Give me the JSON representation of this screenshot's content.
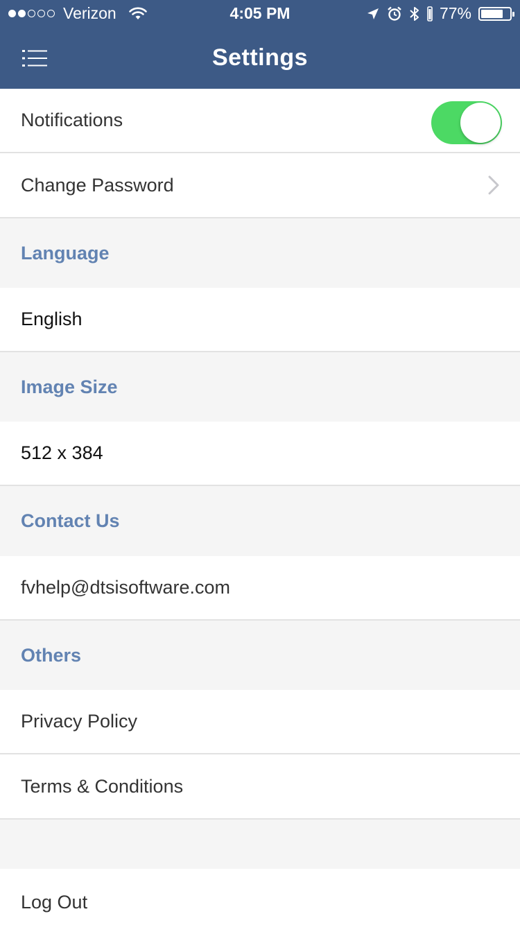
{
  "status_bar": {
    "carrier": "Verizon",
    "time": "4:05 PM",
    "battery_percent": "77%",
    "battery_level": 0.77,
    "signal_bars_filled": 2,
    "signal_bars_total": 5
  },
  "nav": {
    "title": "Settings",
    "menu_icon": "list-menu-icon"
  },
  "rows": {
    "notifications": {
      "label": "Notifications",
      "toggle_on": true
    },
    "change_password": {
      "label": "Change Password"
    }
  },
  "sections": {
    "language": {
      "header": "Language",
      "value": "English"
    },
    "image_size": {
      "header": "Image Size",
      "value": "512 x 384"
    },
    "contact": {
      "header": "Contact Us",
      "value": "fvhelp@dtsisoftware.com"
    },
    "others": {
      "header": "Others",
      "privacy": "Privacy Policy",
      "terms": "Terms & Conditions"
    }
  },
  "logout": {
    "label": "Log Out"
  },
  "colors": {
    "header_bg": "#3d5a86",
    "section_text": "#6283b2",
    "toggle_on": "#4cd964",
    "page_bg": "#f5f5f5"
  }
}
